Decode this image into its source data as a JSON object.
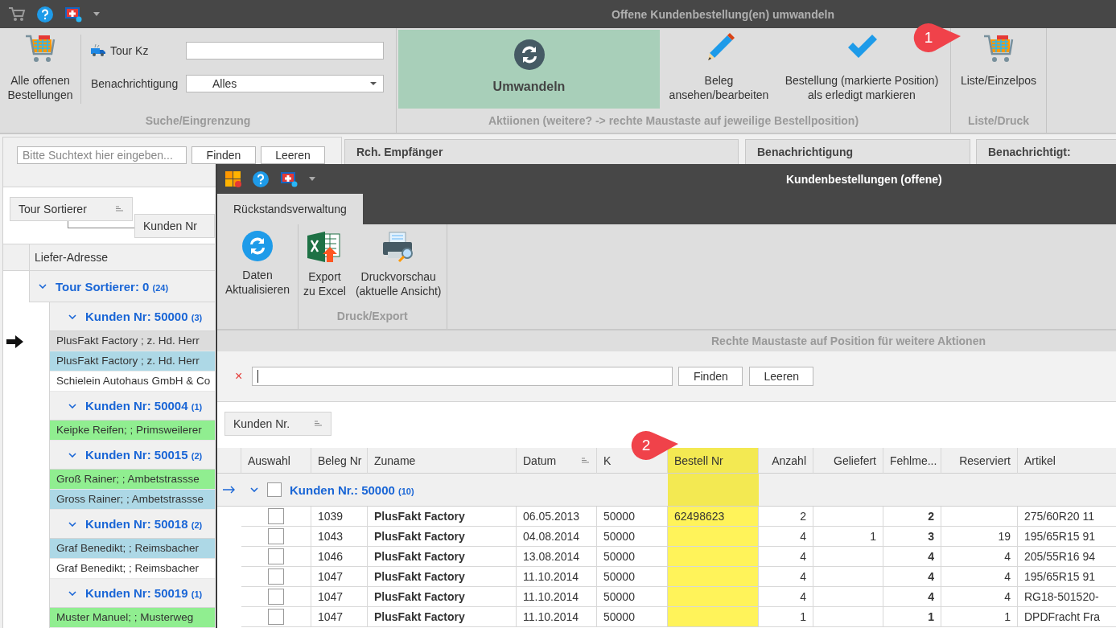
{
  "window": {
    "title": "Offene Kundenbestellung(en) umwandeln"
  },
  "ribbon": {
    "all_orders_button": [
      "Alle offenen",
      "Bestellungen"
    ],
    "tour_field": {
      "label": "Tour Kz"
    },
    "notification_field": {
      "label": "Benachrichtigung",
      "value": "Alles"
    },
    "search_caption": "Suche/Eingrenzung",
    "convert_button": "Umwandeln",
    "view_button": [
      "Beleg",
      "ansehen/bearbeiten"
    ],
    "done_button": [
      "Bestellung (markierte Position)",
      "als erledigt markieren"
    ],
    "actions_caption": "Aktiionen (weitere? -> rechte Maustaste auf jeweilige Bestellposition)",
    "list_button": "Liste/Einzelpos",
    "list_caption": "Liste/Druck",
    "callout": "1"
  },
  "left_panel": {
    "search_placeholder": "Bitte Suchtext hier eingeben...",
    "find_button": "Finden",
    "clear_button": "Leeren",
    "group_chips": [
      "Tour Sortierer",
      "Kunden Nr"
    ],
    "column": "Liefer-Adresse",
    "group": {
      "label": "Tour Sortierer: 0",
      "count": "(24)",
      "expanded": true,
      "children": [
        {
          "label": "Kunden Nr: 50000",
          "count": "(3)",
          "expanded": true,
          "rows": [
            {
              "text": "PlusFakt Factory ; z. Hd. Herr",
              "color": "#dcdcdc",
              "current": true
            },
            {
              "text": "PlusFakt Factory ; z. Hd. Herr",
              "color": "#add8e6",
              "current": false
            },
            {
              "text": "Schielein Autohaus GmbH & Co",
              "color": "#ffffff",
              "current": false
            }
          ]
        },
        {
          "label": "Kunden Nr: 50004",
          "count": "(1)",
          "expanded": true,
          "rows": [
            {
              "text": "Keipke Reifen; ; Primsweilerer",
              "color": "#90ee90",
              "current": false
            }
          ]
        },
        {
          "label": "Kunden Nr: 50015",
          "count": "(2)",
          "expanded": true,
          "rows": [
            {
              "text": "Groß Rainer; ; Ambetstrassse",
              "color": "#90ee90",
              "current": false
            },
            {
              "text": "Gross Rainer; ; Ambetstrassse",
              "color": "#add8e6",
              "current": false
            }
          ]
        },
        {
          "label": "Kunden Nr: 50018",
          "count": "(2)",
          "expanded": true,
          "rows": [
            {
              "text": "Graf Benedikt; ; Reimsbacher",
              "color": "#add8e6",
              "current": false
            },
            {
              "text": "Graf Benedikt; ; Reimsbacher",
              "color": "#ffffff",
              "current": false
            }
          ]
        },
        {
          "label": "Kunden Nr: 50019",
          "count": "(1)",
          "expanded": true,
          "rows": [
            {
              "text": "Muster Manuel; ; Musterweg",
              "color": "#90ee90",
              "current": false
            }
          ]
        }
      ]
    }
  },
  "right_columns": [
    "Rch. Empfänger",
    "Benachrichtigung",
    "Benachrichtigt:"
  ],
  "dialog": {
    "title": "Kundenbestellungen (offene)",
    "tabs": [
      {
        "label": "Rückstandsverwaltung",
        "selected": true
      }
    ],
    "refresh_button": [
      "Daten",
      "Aktualisieren"
    ],
    "export_button": [
      "Export",
      "zu Excel"
    ],
    "preview_button": [
      "Druckvorschau",
      "(aktuelle Ansicht)"
    ],
    "export_caption": "Druck/Export",
    "hint": "Rechte Maustaste auf Position für weitere Aktionen",
    "search": {
      "clear_icon": "×",
      "find_button": "Finden",
      "clear_button": "Leeren"
    },
    "group_chip": "Kunden Nr.",
    "table": {
      "callout": "2",
      "selection_column": "Auswahl",
      "columns": [
        {
          "label": "Beleg Nr",
          "kind": "text",
          "sorted": false,
          "highlight": false
        },
        {
          "label": "Zuname",
          "kind": "bold",
          "sorted": false,
          "highlight": false
        },
        {
          "label": "Datum",
          "kind": "text",
          "sorted": true,
          "highlight": false
        },
        {
          "label": "K",
          "kind": "text",
          "sorted": false,
          "highlight": false
        },
        {
          "label": "Bestell Nr",
          "kind": "text",
          "sorted": false,
          "highlight": true
        },
        {
          "label": "Anzahl",
          "kind": "number",
          "sorted": false,
          "highlight": false
        },
        {
          "label": "Geliefert",
          "kind": "number",
          "sorted": false,
          "highlight": false
        },
        {
          "label": "Fehlme...",
          "kind": "boldnumber",
          "sorted": false,
          "highlight": false
        },
        {
          "label": "Reserviert",
          "kind": "number",
          "sorted": false,
          "highlight": false
        },
        {
          "label": "Artikel",
          "kind": "text",
          "sorted": false,
          "highlight": false
        }
      ],
      "group": {
        "label": "Kunden Nr.: 50000",
        "count": "(10)",
        "expanded": true,
        "checked": false,
        "current": true
      },
      "rows": [
        {
          "checked": false,
          "cells": [
            "1039",
            "PlusFakt Factory",
            "06.05.2013",
            "50000",
            "62498623",
            "2",
            "",
            "2",
            "",
            "275/60R20 11"
          ]
        },
        {
          "checked": false,
          "cells": [
            "1043",
            "PlusFakt Factory",
            "04.08.2014",
            "50000",
            "",
            "4",
            "1",
            "3",
            "19",
            "195/65R15 91"
          ]
        },
        {
          "checked": false,
          "cells": [
            "1046",
            "PlusFakt Factory",
            "13.08.2014",
            "50000",
            "",
            "4",
            "",
            "4",
            "4",
            "205/55R16 94"
          ]
        },
        {
          "checked": false,
          "cells": [
            "1047",
            "PlusFakt Factory",
            "11.10.2014",
            "50000",
            "",
            "4",
            "",
            "4",
            "4",
            "195/65R15 91"
          ]
        },
        {
          "checked": false,
          "cells": [
            "1047",
            "PlusFakt Factory",
            "11.10.2014",
            "50000",
            "",
            "4",
            "",
            "4",
            "4",
            "RG18-501520-"
          ]
        },
        {
          "checked": false,
          "cells": [
            "1047",
            "PlusFakt Factory",
            "11.10.2014",
            "50000",
            "",
            "1",
            "",
            "1",
            "1",
            "DPDFracht Fra"
          ]
        }
      ]
    }
  }
}
